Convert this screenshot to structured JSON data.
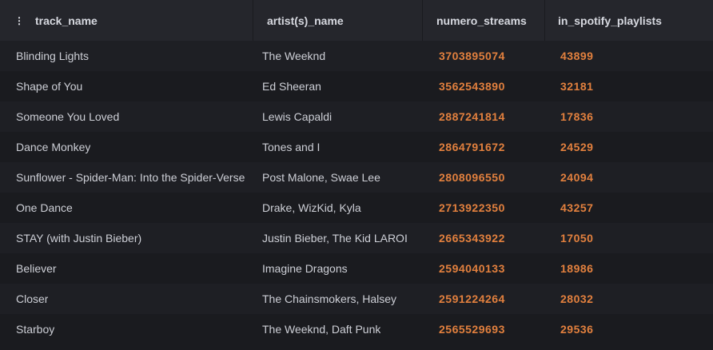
{
  "table": {
    "columns": [
      {
        "label": "track_name"
      },
      {
        "label": "artist(s)_name"
      },
      {
        "label": "numero_streams"
      },
      {
        "label": "in_spotify_playlists"
      }
    ],
    "rows": [
      {
        "track_name": "Blinding Lights",
        "artist": "The Weeknd",
        "streams": "3703895074",
        "playlists": "43899"
      },
      {
        "track_name": "Shape of You",
        "artist": "Ed Sheeran",
        "streams": "3562543890",
        "playlists": "32181"
      },
      {
        "track_name": "Someone You Loved",
        "artist": "Lewis Capaldi",
        "streams": "2887241814",
        "playlists": "17836"
      },
      {
        "track_name": "Dance Monkey",
        "artist": "Tones and I",
        "streams": "2864791672",
        "playlists": "24529"
      },
      {
        "track_name": "Sunflower - Spider-Man: Into the Spider-Verse",
        "artist": "Post Malone, Swae Lee",
        "streams": "2808096550",
        "playlists": "24094"
      },
      {
        "track_name": "One Dance",
        "artist": "Drake, WizKid, Kyla",
        "streams": "2713922350",
        "playlists": "43257"
      },
      {
        "track_name": "STAY (with Justin Bieber)",
        "artist": "Justin Bieber, The Kid LAROI",
        "streams": "2665343922",
        "playlists": "17050"
      },
      {
        "track_name": "Believer",
        "artist": "Imagine Dragons",
        "streams": "2594040133",
        "playlists": "18986"
      },
      {
        "track_name": "Closer",
        "artist": "The Chainsmokers, Halsey",
        "streams": "2591224264",
        "playlists": "28032"
      },
      {
        "track_name": "Starboy",
        "artist": "The Weeknd, Daft Punk",
        "streams": "2565529693",
        "playlists": "29536"
      }
    ]
  },
  "colors": {
    "background": "#1a1b1f",
    "header": "#25262c",
    "numeric_accent": "#e2803e"
  },
  "icons": {
    "drag_handle": "drag-handle-icon"
  }
}
